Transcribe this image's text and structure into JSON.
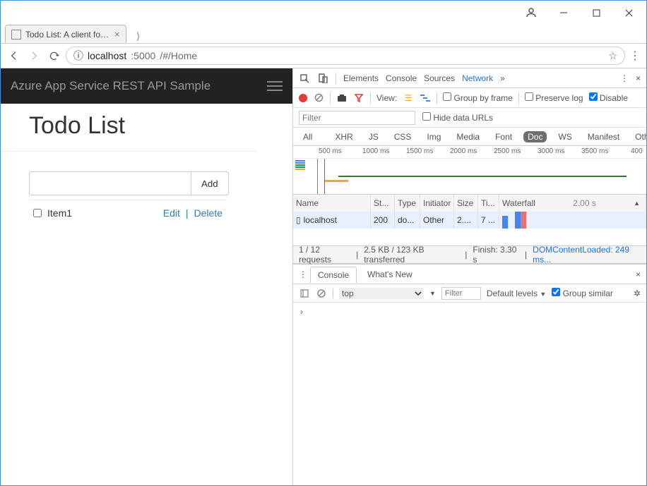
{
  "window": {
    "tab_title": "Todo List: A client for sam"
  },
  "address": {
    "info_icon": "ⓘ",
    "host": "localhost",
    "port": ":5000",
    "path": "/#/Home"
  },
  "app": {
    "brand": "Azure App Service REST API Sample",
    "heading": "Todo List",
    "add_button": "Add",
    "new_item_value": "",
    "items": [
      {
        "label": "Item1",
        "edit": "Edit",
        "delete": "Delete"
      }
    ]
  },
  "devtools": {
    "panels": [
      "Elements",
      "Console",
      "Sources",
      "Network"
    ],
    "active_panel": "Network",
    "toolbar": {
      "view_label": "View:",
      "group_by_frame": "Group by frame",
      "preserve_log": "Preserve log",
      "disable_cache": "Disable"
    },
    "filter": {
      "placeholder": "Filter",
      "hide_data_urls": "Hide data URLs"
    },
    "types": [
      "All",
      "XHR",
      "JS",
      "CSS",
      "Img",
      "Media",
      "Font",
      "Doc",
      "WS",
      "Manifest",
      "Other"
    ],
    "types_active": "Doc",
    "timeline_ticks": [
      "500 ms",
      "1000 ms",
      "1500 ms",
      "2000 ms",
      "2500 ms",
      "3000 ms",
      "3500 ms",
      "400"
    ],
    "net_columns": {
      "name": "Name",
      "status": "St...",
      "type": "Type",
      "initiator": "Initiator",
      "size": "Size",
      "time": "Ti...",
      "waterfall": "Waterfall",
      "scale": "2.00 s"
    },
    "net_rows": [
      {
        "name": "localhost",
        "status": "200",
        "type": "do...",
        "initiator": "Other",
        "size": "2....",
        "time": "7 ..."
      }
    ],
    "footer": {
      "requests": "1 / 12 requests",
      "transfer": "2.5 KB / 123 KB transferred",
      "finish": "Finish: 3.30 s",
      "dom": "DOMContentLoaded: 249 ms..."
    },
    "console": {
      "tabs": [
        "Console",
        "What's New"
      ],
      "context": "top",
      "filter_placeholder": "Filter",
      "levels": "Default levels",
      "group_similar": "Group similar",
      "prompt": "›"
    }
  }
}
